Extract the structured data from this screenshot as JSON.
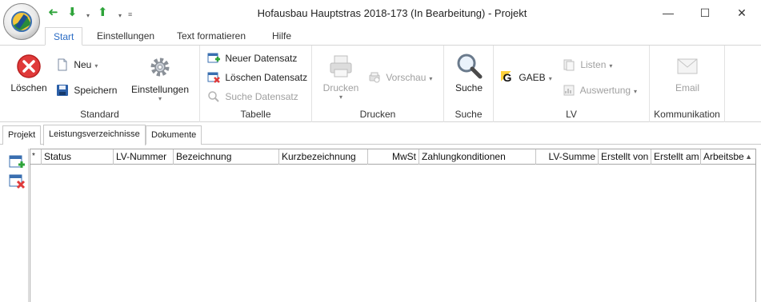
{
  "window": {
    "title": "Hofausbau Hauptstras 2018-173 (In Bearbeitung) - Projekt",
    "controls": {
      "minimize": "—",
      "maximize": "☐",
      "close": "✕"
    }
  },
  "quick_access": {
    "back": "➜",
    "down": "⬇",
    "up": "⬆",
    "dropdown": "▾",
    "customize": "≡"
  },
  "ribbon_tabs": [
    "Start",
    "Einstellungen",
    "Text formatieren",
    "Hilfe"
  ],
  "ribbon_active_tab": "Start",
  "ribbon": {
    "standard": {
      "label": "Standard",
      "delete": "Löschen",
      "new": "Neu",
      "save": "Speichern",
      "settings": "Einstellungen"
    },
    "tabelle": {
      "label": "Tabelle",
      "new_record": "Neuer Datensatz",
      "delete_record": "Löschen Datensatz",
      "search_record": "Suche Datensatz"
    },
    "drucken": {
      "label": "Drucken",
      "print": "Drucken",
      "preview": "Vorschau"
    },
    "suche": {
      "label": "Suche",
      "search": "Suche"
    },
    "lv": {
      "label": "LV",
      "gaeb": "GAEB",
      "lists": "Listen",
      "evaluation": "Auswertung"
    },
    "kommunikation": {
      "label": "Kommunikation",
      "email": "Email"
    }
  },
  "doc_tabs": [
    "Projekt",
    "Leistungsverzeichnisse",
    "Dokumente"
  ],
  "doc_active_tab": "Leistungsverzeichnisse",
  "grid": {
    "marker": "*",
    "columns": [
      "Status",
      "LV-Nummer",
      "Bezeichnung",
      "Kurzbezeichnung",
      "MwSt",
      "Zahlungkonditionen",
      "LV-Summe",
      "Erstellt von",
      "Erstellt am",
      "Arbeitsbe"
    ],
    "rows": []
  },
  "colors": {
    "accent": "#2b6cc4",
    "delete_red": "#e03a3a",
    "green_arrow": "#2ea43a"
  }
}
